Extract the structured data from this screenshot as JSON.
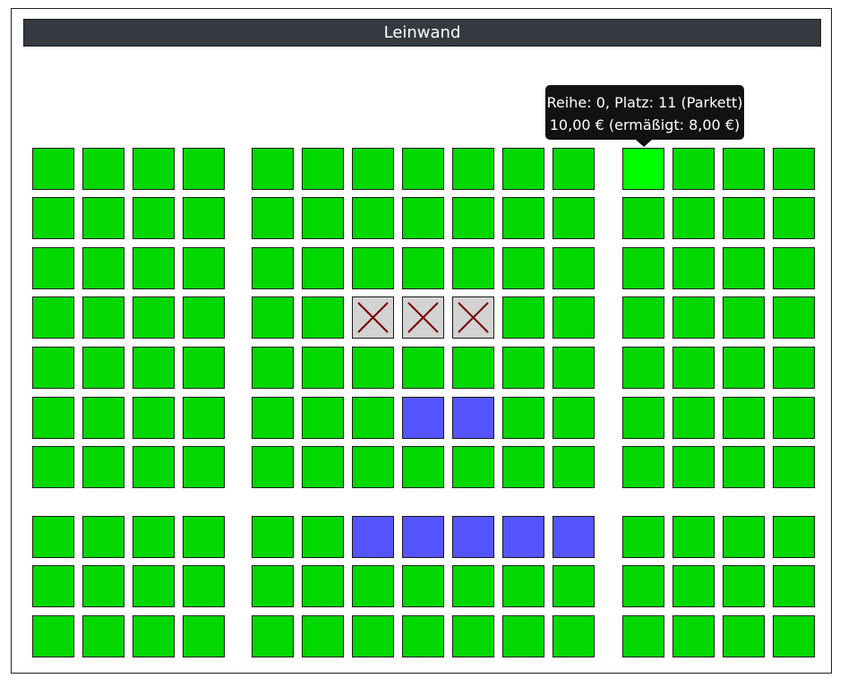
{
  "screen": {
    "label": "Leinwand"
  },
  "tooltip": {
    "line1": "Reihe: 0, Platz: 11 (Parkett)",
    "line2": "10,00 € (ermäßigt: 8,00 €)"
  },
  "colors": {
    "available": "#00d800",
    "selected": "#5555ff",
    "hover": "#00ff00",
    "occupied": "#d3d3d3",
    "occupied_mark": "#7a0000"
  },
  "seating": {
    "rows": 10,
    "seats_per_row": 15,
    "blocks": [
      4,
      7,
      4
    ],
    "occupied": [
      [
        3,
        6
      ],
      [
        3,
        7
      ],
      [
        3,
        8
      ]
    ],
    "selected": [
      [
        5,
        7
      ],
      [
        5,
        8
      ],
      [
        7,
        6
      ],
      [
        7,
        7
      ],
      [
        7,
        8
      ],
      [
        7,
        9
      ],
      [
        7,
        10
      ]
    ],
    "hovered": [
      0,
      11
    ]
  }
}
